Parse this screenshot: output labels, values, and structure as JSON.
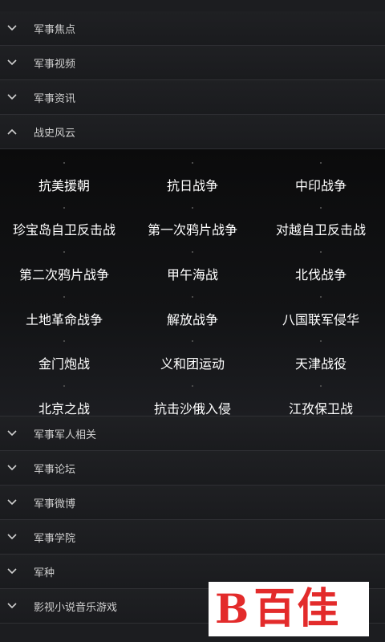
{
  "sections_top": [
    {
      "label": "军事焦点",
      "state": "collapsed"
    },
    {
      "label": "军事视频",
      "state": "collapsed"
    },
    {
      "label": "军事资讯",
      "state": "collapsed"
    },
    {
      "label": "战史风云",
      "state": "expanded"
    }
  ],
  "expanded_items": [
    "抗美援朝",
    "抗日战争",
    "中印战争",
    "珍宝岛自卫反击战",
    "第一次鸦片战争",
    "对越自卫反击战",
    "第二次鸦片战争",
    "甲午海战",
    "北伐战争",
    "土地革命战争",
    "解放战争",
    "八国联军侵华",
    "金门炮战",
    "义和团运动",
    "天津战役",
    "北京之战",
    "抗击沙俄入侵",
    "江孜保卫战"
  ],
  "sections_bottom": [
    {
      "label": "军事军人相关",
      "state": "collapsed"
    },
    {
      "label": "军事论坛",
      "state": "collapsed"
    },
    {
      "label": "军事微博",
      "state": "collapsed"
    },
    {
      "label": "军事学院",
      "state": "collapsed"
    },
    {
      "label": "军种",
      "state": "collapsed"
    },
    {
      "label": "影视小说音乐游戏",
      "state": "collapsed"
    }
  ],
  "watermark": {
    "mark": "B",
    "text": "百佳"
  },
  "colors": {
    "background": "#1c1d20",
    "accent_watermark": "#e32b2b",
    "text": "#ffffff"
  },
  "icons": {
    "collapsed": "chevron-down-icon",
    "expanded": "chevron-up-icon"
  }
}
